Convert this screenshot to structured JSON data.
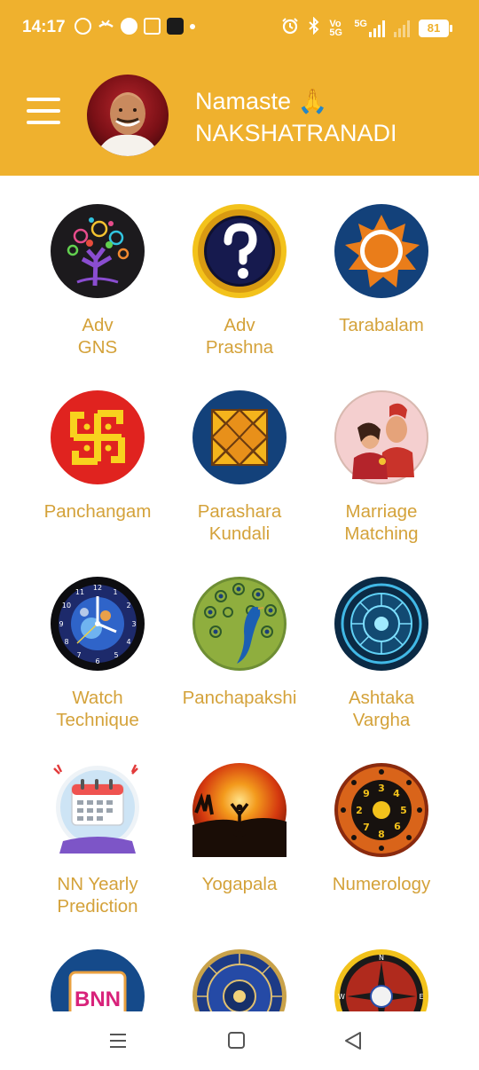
{
  "status_bar": {
    "time": "14:17",
    "volte": "Vo\n5G",
    "network": "5G",
    "battery": "81"
  },
  "header": {
    "greeting_line1": "Namaste 🙏",
    "greeting_line2": "NAKSHATRANADI",
    "background_color": "#efb12e"
  },
  "menu": [
    {
      "id": "adv-gns",
      "label": "Adv\nGNS"
    },
    {
      "id": "adv-prashna",
      "label": "Adv\nPrashna"
    },
    {
      "id": "tarabalam",
      "label": "Tarabalam"
    },
    {
      "id": "panchangam",
      "label": "Panchangam"
    },
    {
      "id": "parashara-kundali",
      "label": "Parashara\nKundali"
    },
    {
      "id": "marriage-matching",
      "label": "Marriage\nMatching"
    },
    {
      "id": "watch-technique",
      "label": "Watch\nTechnique"
    },
    {
      "id": "panchapakshi",
      "label": "Panchapakshi"
    },
    {
      "id": "ashtaka-vargha",
      "label": "Ashtaka\nVargha"
    },
    {
      "id": "nn-yearly-prediction",
      "label": "NN Yearly\nPrediction"
    },
    {
      "id": "yogapala",
      "label": "Yogapala"
    },
    {
      "id": "numerology",
      "label": "Numerology"
    },
    {
      "id": "bnn",
      "label": "",
      "logo_text": "BNN"
    },
    {
      "id": "zodiac-wheel",
      "label": ""
    },
    {
      "id": "compass",
      "label": ""
    }
  ],
  "label_color": "#d4a23a"
}
